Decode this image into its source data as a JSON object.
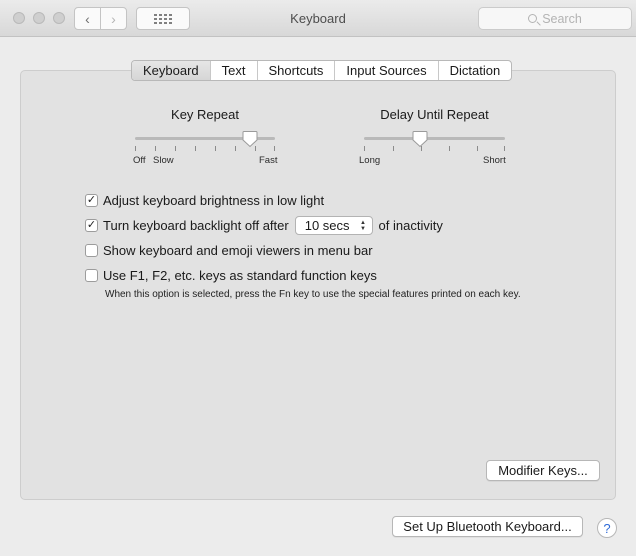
{
  "window": {
    "title": "Keyboard",
    "search_placeholder": "Search"
  },
  "toolbar": {
    "back_icon": "‹",
    "forward_icon": "›"
  },
  "tabs": [
    {
      "label": "Keyboard",
      "selected": true
    },
    {
      "label": "Text",
      "selected": false
    },
    {
      "label": "Shortcuts",
      "selected": false
    },
    {
      "label": "Input Sources",
      "selected": false
    },
    {
      "label": "Dictation",
      "selected": false
    }
  ],
  "key_repeat": {
    "title": "Key Repeat",
    "label_left_1": "Off",
    "label_left_2": "Slow",
    "label_right": "Fast",
    "level": 0.82
  },
  "delay_until_repeat": {
    "title": "Delay Until Repeat",
    "label_left": "Long",
    "label_right": "Short",
    "level": 0.4
  },
  "options": {
    "brightness": {
      "label": "Adjust keyboard brightness in low light",
      "checked": true
    },
    "backlight": {
      "label": "Turn keyboard backlight off after",
      "checked": true,
      "suffix": "of inactivity"
    },
    "viewers": {
      "label": "Show keyboard and emoji viewers in menu bar",
      "checked": false
    },
    "function_keys": {
      "label": "Use F1, F2, etc. keys as standard function keys",
      "checked": false
    }
  },
  "backlight_popup": {
    "value": "10 secs"
  },
  "function_keys_note": "When this option is selected, press the Fn key to use the special features printed on each key.",
  "buttons": {
    "modifier_keys": "Modifier Keys...",
    "bluetooth": "Set Up Bluetooth Keyboard...",
    "help": "?"
  },
  "checkmark": "✓"
}
